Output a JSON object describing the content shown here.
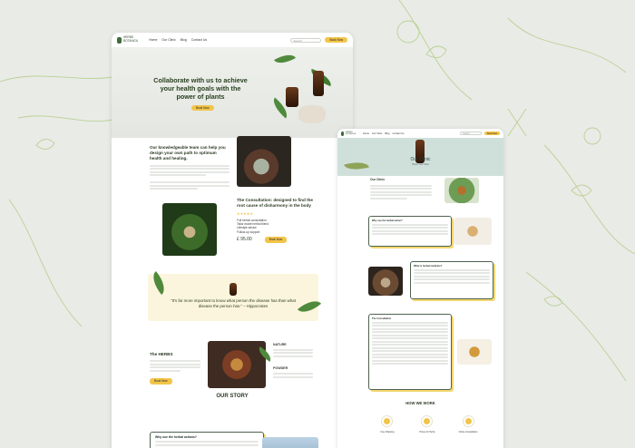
{
  "nav": {
    "logo_line1": "HERBS",
    "logo_line2": "BOTANICA",
    "links": [
      "Home",
      "Our Clinic",
      "Blog",
      "Contact Us"
    ],
    "search_placeholder": "Search",
    "cta": "Book Now"
  },
  "hero": {
    "title": "Collaborate with us to achieve your health goals with the power of plants",
    "cta": "Book Now"
  },
  "intro": {
    "heading": "Our knowledgeable team can help you design your own path to optimum health and healing."
  },
  "consultation": {
    "heading": "The Consultation: designed to find the root cause of disharmony in the body",
    "bullets": [
      "Full herbal consultation",
      "Tailor-made herbal blend",
      "Lifestyle advice",
      "Follow-up support"
    ],
    "price": "£ 95.00",
    "cta": "Book Now"
  },
  "quote": {
    "text": "\"It's far more important to know what person the disease has than what disease the person has.\" – Hippocrates"
  },
  "herbs_section": {
    "label": "The HERBS",
    "cta": "Book Now",
    "right_top": "NATURE",
    "right_bottom": "POWDER"
  },
  "story": {
    "heading": "OUR STORY",
    "card_title": "Why use the herbal actions?"
  },
  "clinic": {
    "hero_title": "Our Clinic",
    "breadcrumb": "Home / Our Clinic",
    "section_title": "Our Clinic",
    "card1_title": "Why use the herbal action?",
    "card2_title": "What is herbal medicine?",
    "card3_title": "The Consultation",
    "how_we_work": "HOW WE WORK",
    "steps": [
      "Free Shipping",
      "Prices for Herbs",
      "Online Consultation"
    ]
  },
  "colors": {
    "accent_yellow": "#f2c54a",
    "forest_green": "#2d3b27",
    "clinic_teal": "#cfe0db",
    "quote_cream": "#fcf5dd"
  }
}
